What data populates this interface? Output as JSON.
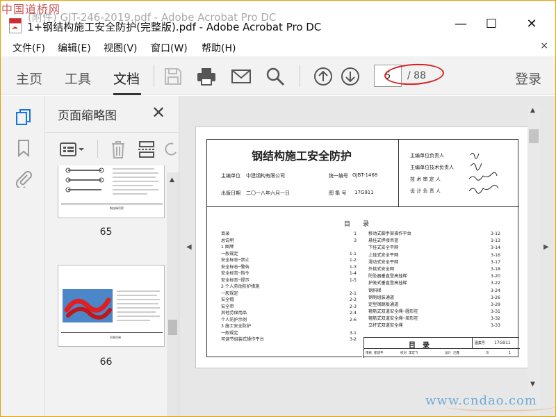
{
  "watermark_top": "中国道桥网",
  "watermark_bottom": "www.cndao.com",
  "ghost_title": "(附件) GJT-246-2019.pdf - Adobe Acrobat Pro DC",
  "window": {
    "title": "1+钢结构施工安全防护(完整版).pdf - Adobe Acrobat Pro DC",
    "minimize": "—",
    "maximize": "☐",
    "close": "✕"
  },
  "menu": {
    "items": [
      "文件(F)",
      "编辑(E)",
      "视图(V)",
      "窗口(W)",
      "帮助(H)"
    ],
    "close": "×"
  },
  "toolbar": {
    "tabs": [
      "主页",
      "工具",
      "文档"
    ],
    "active_tab": "文档",
    "icons": [
      "save-icon",
      "print-icon",
      "email-icon",
      "search-icon",
      "page-up-icon",
      "page-down-icon"
    ],
    "page_current": "5",
    "page_total": "/ 88",
    "login": "登录"
  },
  "thumbnails": {
    "title": "页面缩略图",
    "close": "✕",
    "pages": [
      {
        "number": "65",
        "caption": "钢丝绳吊索"
      },
      {
        "number": "66",
        "caption": "吊装吊带"
      }
    ]
  },
  "document": {
    "title": "钢结构施工安全防护",
    "org_label": "主编单位",
    "org": "中建钢构有限公司",
    "code_label": "统一编号",
    "code": "GJBT-1468",
    "date_label": "出版日期",
    "date": "二〇一八年六月一日",
    "atlas_label": "图 集 号",
    "atlas": "17G911",
    "responsibles": [
      "主编单位负责人",
      "主编单位技术负责人",
      "技 术 审 定 人",
      "设 计 负 责 人"
    ],
    "toc_heading": "目　　录",
    "toc_left": [
      [
        "目录",
        "1"
      ],
      [
        "总说明",
        "3"
      ],
      [
        "1 图牌",
        ""
      ],
      [
        "一般规定",
        "1-1"
      ],
      [
        "安全标志─禁止",
        "1-2"
      ],
      [
        "安全标志─警告",
        "1-3"
      ],
      [
        "安全标志─指令",
        "1-4"
      ],
      [
        "安全标志─提示",
        "1-5"
      ],
      [
        "2 个人劳动防护措施",
        ""
      ],
      [
        "一般规定",
        "2-1"
      ],
      [
        "安全帽",
        "2-2"
      ],
      [
        "安全带",
        "2-3"
      ],
      [
        "其他劳保用品",
        "2-4"
      ],
      [
        "个人防护示例",
        "2-6"
      ],
      [
        "3 施工安全防护",
        ""
      ],
      [
        "一般规定",
        "3-1"
      ],
      [
        "可调节组装式操作平台",
        "3-2"
      ]
    ],
    "toc_right": [
      [
        "移动式脚手架操作平台",
        "3-12"
      ],
      [
        "悬挂式焊接吊篮",
        "3-13"
      ],
      [
        "下挂式安全平网",
        "3-14"
      ],
      [
        "上挂式安全平网",
        "3-16"
      ],
      [
        "滑动式安全平网",
        "3-17"
      ],
      [
        "外挑式安全网",
        "3-18"
      ],
      [
        "防坠器垂直登高挂梯",
        "3-20"
      ],
      [
        "护笼式垂直登高挂梯",
        "3-22"
      ],
      [
        "钢斜梯",
        "3-24"
      ],
      [
        "钢制组装通道",
        "3-26"
      ],
      [
        "定型钢跳板通道",
        "3-29"
      ],
      [
        "箍筋式双道安全绳─圆形柱",
        "3-31"
      ],
      [
        "箍筋式双道安全绳─矩形柱",
        "3-32"
      ],
      [
        "立杆式双道安全绳",
        "3-33"
      ]
    ],
    "footer_title": "目　录",
    "footer_atlas_label": "图集号",
    "footer_atlas": "17G911",
    "footer_row": [
      "审核",
      "崔建平",
      "校对",
      "李宏飞",
      "设计",
      "汪鑫",
      "页",
      "1"
    ]
  },
  "colors": {
    "accent": "#1473e6",
    "annotation": "#d51f1f",
    "toolbar_bg": "#f2f2f2",
    "doc_bg": "#e7e7e7"
  }
}
